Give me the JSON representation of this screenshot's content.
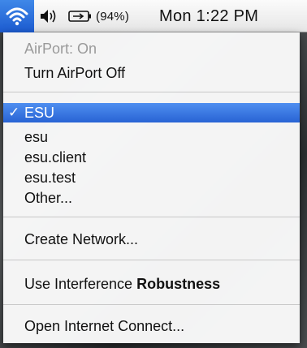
{
  "menubar": {
    "battery_percent": "(94%)",
    "clock": "Mon 1:22 PM"
  },
  "menu": {
    "airport_status": "AirPort: On",
    "turn_off": "Turn AirPort Off",
    "networks": {
      "selected": "ESU",
      "items": [
        "esu",
        "esu.client",
        "esu.test"
      ]
    },
    "other": "Other...",
    "create_network": "Create Network...",
    "interference": {
      "prefix": "Use Interference ",
      "bold": "Robustness"
    },
    "open_connect": "Open Internet Connect..."
  },
  "colors": {
    "selection": "#2f6fe0",
    "menubar_highlight": "#2a6fe0"
  },
  "icons": [
    "wifi-icon",
    "volume-icon",
    "battery-icon",
    "checkmark-icon"
  ]
}
